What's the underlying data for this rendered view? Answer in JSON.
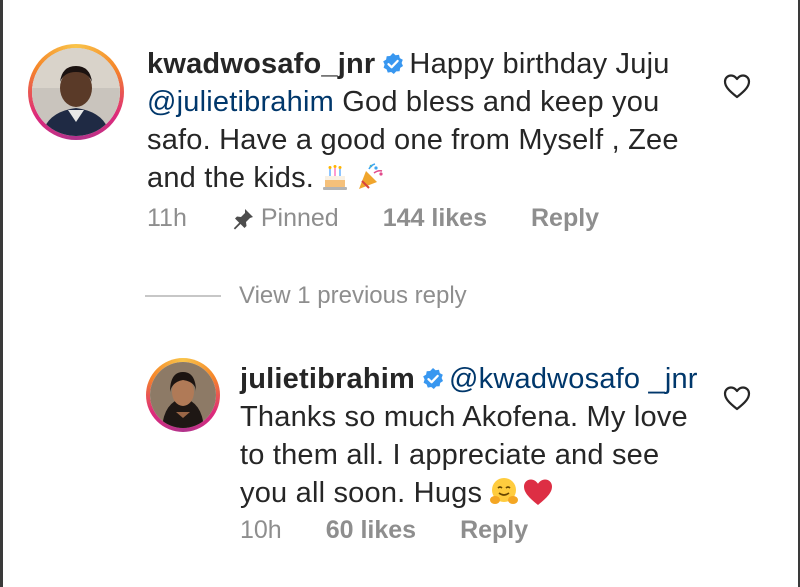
{
  "comment": {
    "username": "kwadwosafo_jnr",
    "text_before_mention": "Happy birthday Juju",
    "mention": "@julietibrahim",
    "text_after_mention": "God bless and keep you safo. Have a good one from Myself , Zee and the kids.",
    "emojis": [
      "birthday-cake",
      "party-popper"
    ],
    "time": "11h",
    "pinned_label": "Pinned",
    "likes": "144 likes",
    "reply_label": "Reply"
  },
  "view_replies": "View 1 previous reply",
  "reply": {
    "username": "julietibrahim",
    "mention": "@kwadwosafo _jnr",
    "text": "Thanks so much Akofena. My love to them all. I appreciate and see you all soon. Hugs",
    "emojis": [
      "hugging-face",
      "red-heart"
    ],
    "time": "10h",
    "likes": "60 likes",
    "reply_label": "Reply"
  },
  "colors": {
    "mention": "#00376b",
    "verified": "#3897f0",
    "meta_text": "#8e8e8e"
  }
}
